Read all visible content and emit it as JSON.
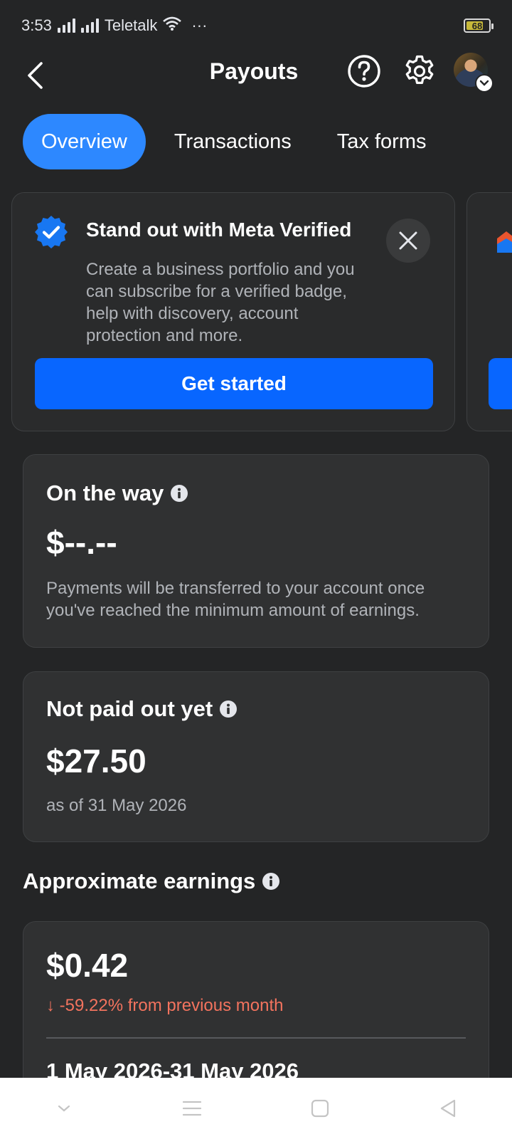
{
  "status_bar": {
    "time": "3:53",
    "carrier": "Teletalk",
    "more": "···",
    "battery": "68"
  },
  "header": {
    "title": "Payouts",
    "icons": [
      "back-icon",
      "help-icon",
      "gear-icon",
      "avatar",
      "chevron-down-icon"
    ]
  },
  "tabs": [
    {
      "label": "Overview",
      "active": true
    },
    {
      "label": "Transactions",
      "active": false
    },
    {
      "label": "Tax forms",
      "active": false
    }
  ],
  "promo": {
    "title": "Stand out with Meta Verified",
    "body": "Create a business portfolio and you can subscribe for a verified badge, help with discovery, account protection and more.",
    "cta": "Get started"
  },
  "on_the_way": {
    "heading": "On the way",
    "amount": "$--.--",
    "note": "Payments will be transferred to your account once you've reached the minimum amount of earnings."
  },
  "not_paid": {
    "heading": "Not paid out yet",
    "amount": "$27.50",
    "as_of": "as of 31 May 2026"
  },
  "approx_earnings": {
    "section_title": "Approximate earnings",
    "amount": "$0.42",
    "change": "↓ -59.22% from previous month",
    "date_range": "1 May 2026-31 May 2026"
  },
  "colors": {
    "background": "#242526",
    "accent_blue": "#0866ff",
    "tab_active": "#2d88ff",
    "negative_change": "#f3735e"
  }
}
